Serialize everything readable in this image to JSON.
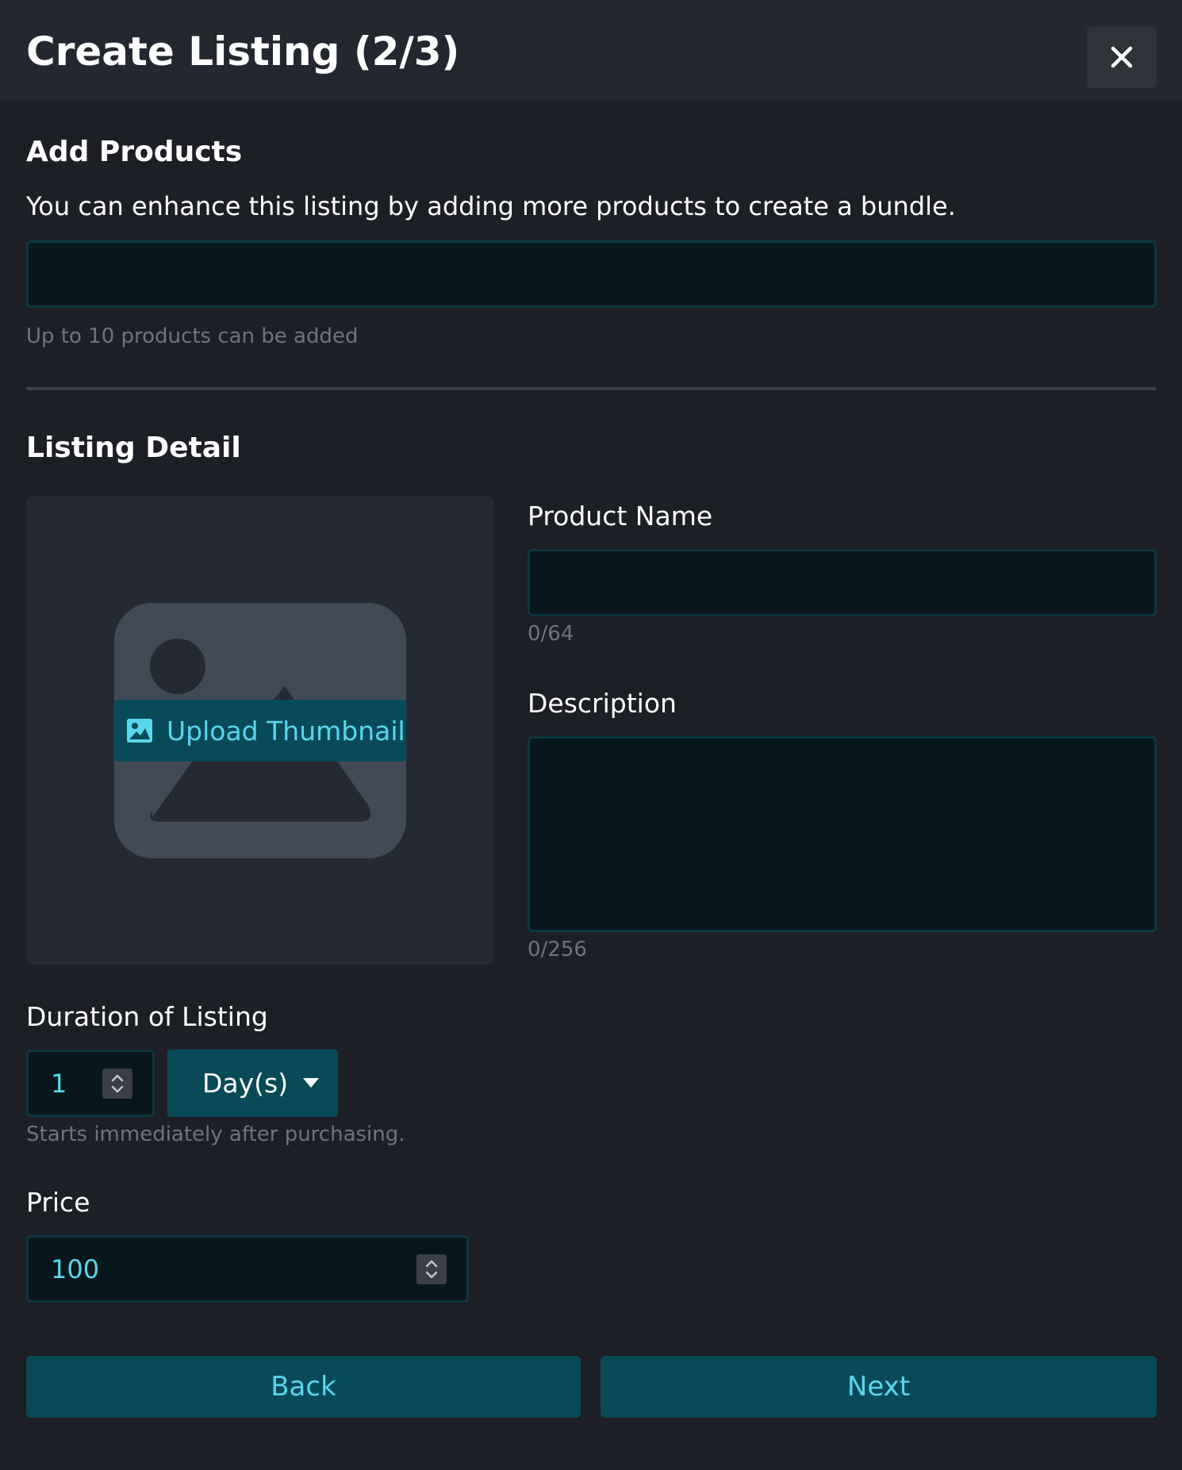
{
  "modal": {
    "title": "Create Listing (2/3)",
    "close_icon": "close-icon"
  },
  "add_products": {
    "heading": "Add Products",
    "description": "You can enhance this listing by adding more products to create a bundle.",
    "search_value": "",
    "hint": "Up to 10 products can be added"
  },
  "listing_detail": {
    "heading": "Listing Detail",
    "thumbnail": {
      "placeholder_icon": "image-placeholder-icon",
      "upload_icon": "image-icon",
      "upload_label": "Upload Thumbnail"
    },
    "product_name": {
      "label": "Product Name",
      "value": "",
      "counter": "0/64"
    },
    "description": {
      "label": "Description",
      "value": "",
      "counter": "0/256"
    }
  },
  "duration": {
    "label": "Duration of Listing",
    "value": "1",
    "unit": "Day(s)",
    "hint": "Starts immediately after purchasing."
  },
  "price": {
    "label": "Price",
    "value": "100"
  },
  "footer": {
    "back_label": "Back",
    "next_label": "Next"
  },
  "colors": {
    "background": "#1c1f26",
    "header": "#232830",
    "accent": "#5ad6ec",
    "button": "#094a59",
    "input_bg": "#07171d",
    "input_border": "#0d3640"
  }
}
